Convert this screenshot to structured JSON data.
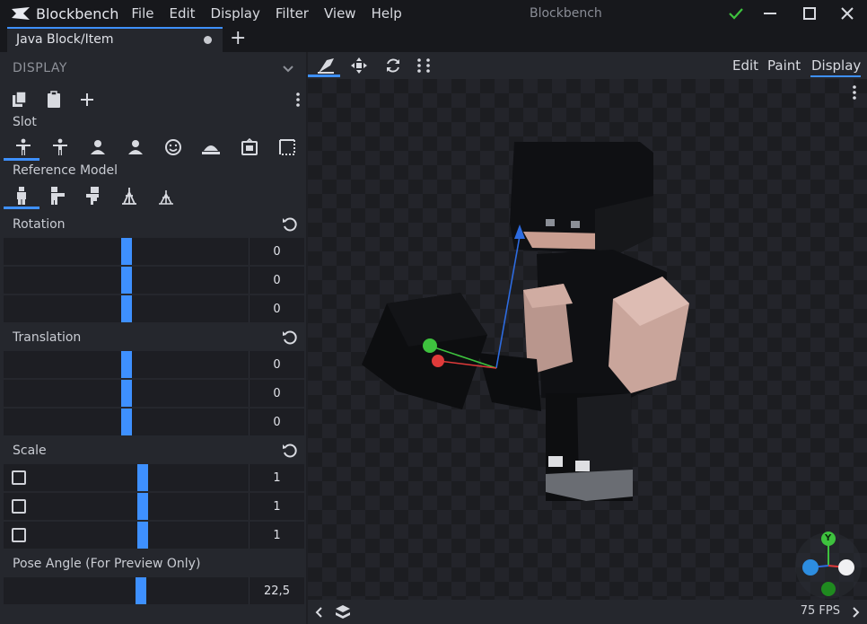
{
  "app": {
    "name": "Blockbench",
    "window_title": "Blockbench"
  },
  "menu": [
    "File",
    "Edit",
    "Display",
    "Filter",
    "View",
    "Help"
  ],
  "tab": {
    "label": "Java Block/Item"
  },
  "panel": {
    "title": "DISPLAY",
    "slot_label": "Slot",
    "reference_label": "Reference Model",
    "rotation": {
      "label": "Rotation",
      "values": [
        "0",
        "0",
        "0"
      ]
    },
    "translation": {
      "label": "Translation",
      "values": [
        "0",
        "0",
        "0"
      ]
    },
    "scale": {
      "label": "Scale",
      "values": [
        "1",
        "1",
        "1"
      ]
    },
    "pose": {
      "label": "Pose Angle (For Preview Only)",
      "value": "22,5"
    }
  },
  "viewport": {
    "modes": [
      "Edit",
      "Paint",
      "Display"
    ],
    "active_mode": "Display",
    "fps": "75 FPS",
    "gizmo_y_label": "Y"
  },
  "colors": {
    "accent": "#3e90ff",
    "axis_x": "#e03a3a",
    "axis_y": "#3ec23e",
    "axis_z": "#2d6be0"
  },
  "icons": {
    "slot": [
      "thirdperson-righthand-icon",
      "thirdperson-lefthand-icon",
      "firstperson-righthand-icon",
      "firstperson-lefthand-icon",
      "head-icon",
      "ground-icon",
      "item-frame-icon",
      "gui-icon"
    ],
    "reference": [
      "player-icon",
      "zombie-icon",
      "armor-stand-icon",
      "baby-zombie-icon",
      "small-armor-stand-icon"
    ]
  }
}
